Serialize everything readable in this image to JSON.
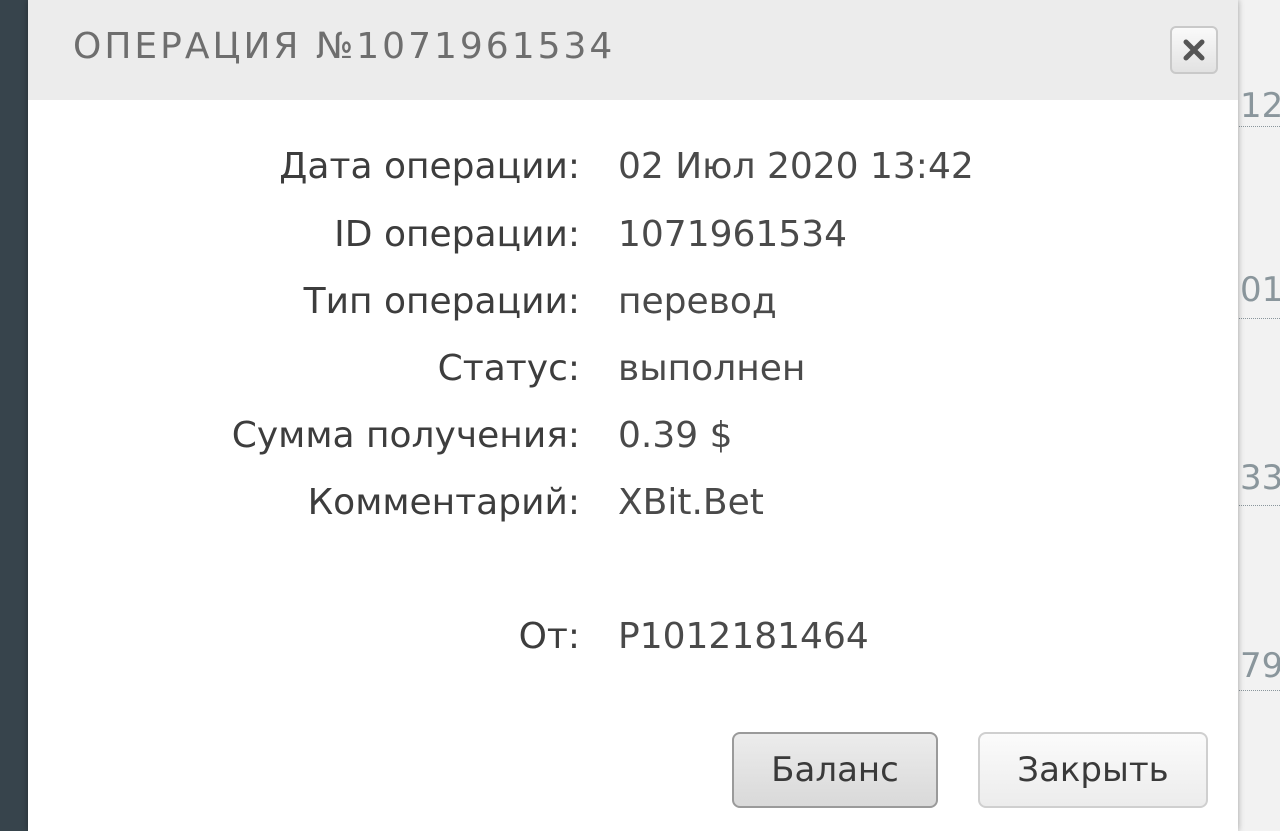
{
  "dialog": {
    "title": "ОПЕРАЦИЯ №1071961534",
    "close_icon": "close-icon"
  },
  "details": [
    {
      "label": "Дата операции:",
      "value": "02 Июл 2020 13:42"
    },
    {
      "label": "ID операции:",
      "value": "1071961534"
    },
    {
      "label": "Тип операции:",
      "value": "перевод"
    },
    {
      "label": "Статус:",
      "value": "выполнен"
    },
    {
      "label": "Сумма получения:",
      "value": "0.39 $"
    },
    {
      "label": "Комментарий:",
      "value": "XBit.Bet"
    }
  ],
  "from": {
    "label": "От:",
    "value": "P1012181464"
  },
  "buttons": {
    "balance": "Баланс",
    "close": "Закрыть"
  },
  "background_fragments": [
    "12",
    "01",
    "33",
    "79"
  ],
  "colors": {
    "backdrop": "#37444c",
    "titlebar": "#ececec",
    "dialog": "#ffffff",
    "text": "#3d3d3d"
  }
}
